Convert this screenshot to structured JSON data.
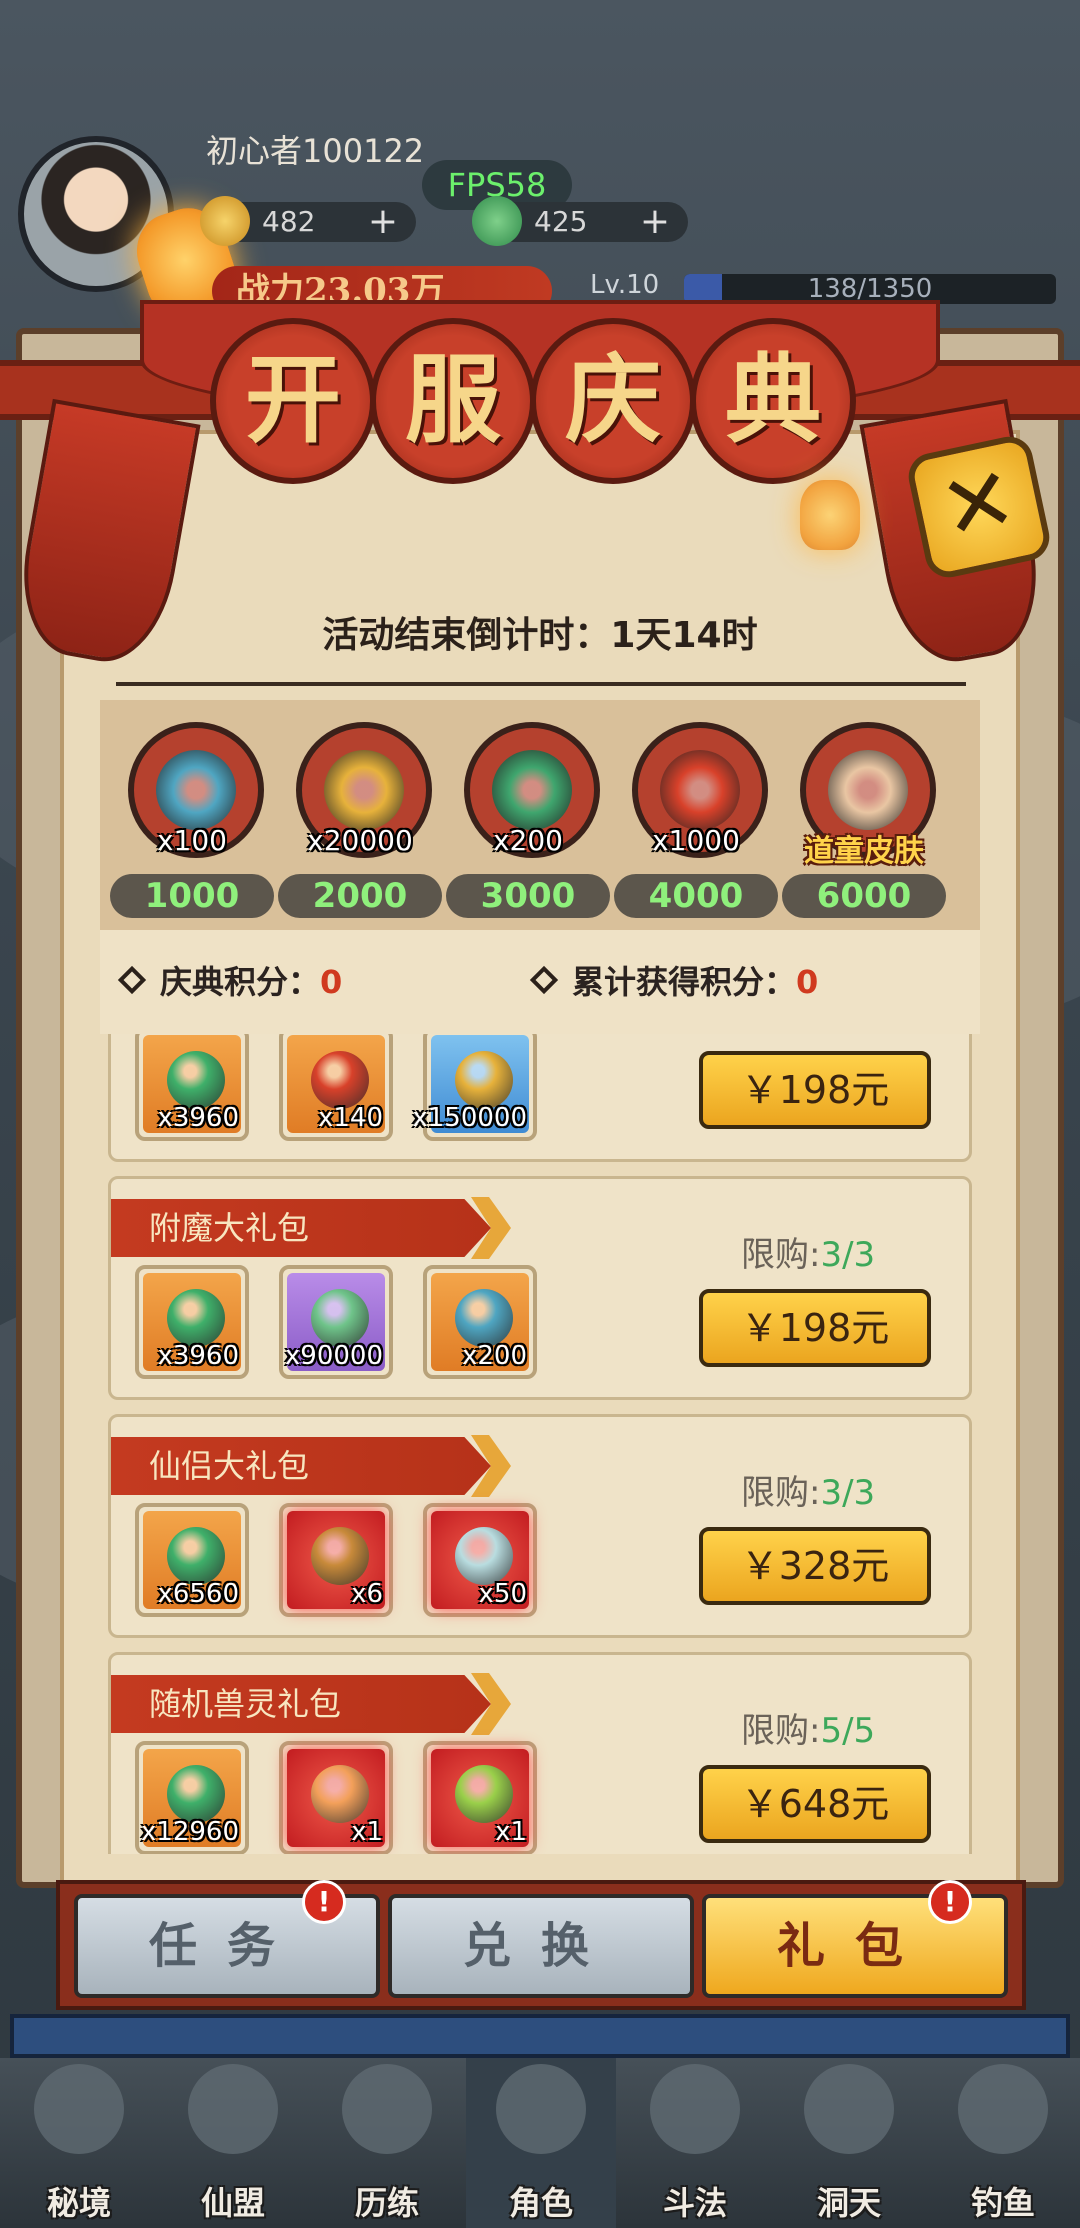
{
  "player": {
    "name": "初心者100122",
    "fps": "FPS58",
    "currency1": "482",
    "currency2": "425",
    "power": "战力23.03万",
    "level": "Lv.10",
    "exp": "138/1350",
    "exp_fraction": 0.102
  },
  "event": {
    "title_chars": [
      "开",
      "服",
      "庆",
      "典"
    ],
    "countdown": "活动结束倒计时：1天14时",
    "close_icon": "close-icon"
  },
  "milestones": [
    {
      "qty": "x100",
      "score": "1000",
      "icon": "teapot-icon",
      "color": "#4fa6c2"
    },
    {
      "qty": "x20000",
      "score": "2000",
      "icon": "gold-coin-icon",
      "color": "#e7b23b"
    },
    {
      "qty": "x200",
      "score": "3000",
      "icon": "jade-orb-icon",
      "color": "#3fa66e"
    },
    {
      "qty": "x1000",
      "score": "4000",
      "icon": "red-crystal-icon",
      "color": "#d8412a"
    },
    {
      "qty": "",
      "score": "6000",
      "icon": "skin-portrait-icon",
      "skin_label": "道童皮肤",
      "color": "#e9c6a3"
    }
  ],
  "points": {
    "celebration_label": "庆典积分：",
    "celebration_value": "0",
    "total_label": "累计获得积分：",
    "total_value": "0"
  },
  "packs": [
    {
      "name": "",
      "limit_label": "",
      "limit": "",
      "price": "￥198元",
      "items": [
        {
          "qty": "x3960",
          "rarity": "orange",
          "color": "#3fb06a"
        },
        {
          "qty": "x140",
          "rarity": "orange",
          "color": "#d8412a"
        },
        {
          "qty": "x150000",
          "rarity": "blue",
          "color": "#e7b23b"
        }
      ]
    },
    {
      "name": "附魔大礼包",
      "limit_label": "限购:",
      "limit": "3/3",
      "price": "￥198元",
      "items": [
        {
          "qty": "x3960",
          "rarity": "orange",
          "color": "#3fb06a"
        },
        {
          "qty": "x90000",
          "rarity": "purple",
          "color": "#6fc48a"
        },
        {
          "qty": "x200",
          "rarity": "orange",
          "color": "#4fa6c2"
        }
      ]
    },
    {
      "name": "仙侣大礼包",
      "limit_label": "限购:",
      "limit": "3/3",
      "price": "￥328元",
      "items": [
        {
          "qty": "x6560",
          "rarity": "orange",
          "color": "#3fb06a"
        },
        {
          "qty": "x6",
          "rarity": "red",
          "color": "#c88a3a"
        },
        {
          "qty": "x50",
          "rarity": "red",
          "color": "#b9dde0"
        }
      ]
    },
    {
      "name": "随机兽灵礼包",
      "limit_label": "限购:",
      "limit": "5/5",
      "price": "￥648元",
      "items": [
        {
          "qty": "x12960",
          "rarity": "orange",
          "color": "#3fb06a"
        },
        {
          "qty": "x1",
          "rarity": "red",
          "color": "#f3a05a"
        },
        {
          "qty": "x1",
          "rarity": "red",
          "color": "#9ad04a"
        }
      ]
    }
  ],
  "tabs": [
    {
      "label": "任务",
      "badge": "!"
    },
    {
      "label": "兑换",
      "badge": ""
    },
    {
      "label": "礼包",
      "badge": "!"
    }
  ],
  "nav": [
    "秘境",
    "仙盟",
    "历练",
    "角色",
    "斗法",
    "洞天",
    "钓鱼"
  ]
}
